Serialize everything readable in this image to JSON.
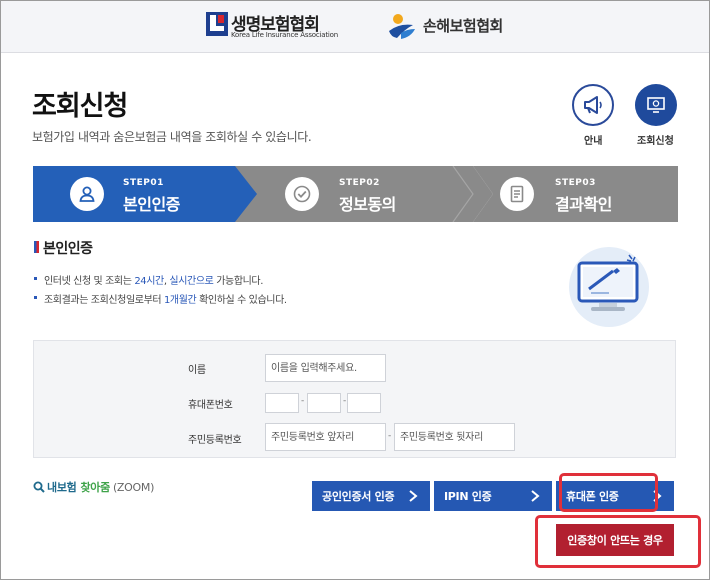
{
  "header": {
    "life_logo_kr": "생명보험협회",
    "life_logo_en": "Korea Life Insurance Association",
    "general_logo": "손해보험협회"
  },
  "page": {
    "title": "조회신청",
    "subtitle": "보험가입 내역과 숨은보험금 내역을 조회하실 수 있습니다."
  },
  "quick_buttons": {
    "guide_label": "안내",
    "guide_icon": "megaphone-icon",
    "request_label": "조회신청",
    "request_icon": "monitor-icon"
  },
  "steps": [
    {
      "num": "STEP01",
      "name": "본인인증",
      "icon": "person-icon",
      "active": true
    },
    {
      "num": "STEP02",
      "name": "정보동의",
      "icon": "check-icon",
      "active": false
    },
    {
      "num": "STEP03",
      "name": "결과확인",
      "icon": "document-icon",
      "active": false
    }
  ],
  "section": {
    "title": "본인인증",
    "bullet1_a": "인터넷 신청 및 조회는 ",
    "bullet1_b": "24시간",
    "bullet1_c": ", ",
    "bullet1_d": "실시간으로",
    "bullet1_e": " 가능합니다.",
    "bullet2_a": "조회결과는 조회신청일로부터 ",
    "bullet2_b": "1개월간",
    "bullet2_c": " 확인하실 수 있습니다."
  },
  "form": {
    "name_label": "이름",
    "name_placeholder": "이름을 입력해주세요.",
    "phone_label": "휴대폰번호",
    "ssn_label": "주민등록번호",
    "ssn_front_placeholder": "주민등록번호 앞자리",
    "ssn_back_placeholder": "주민등록번호 뒷자리"
  },
  "zoom_link": {
    "part1": "내보험",
    "part2": "찾아줌",
    "part3": "(ZOOM)"
  },
  "auth_buttons": {
    "cert": "공인인증서 인증",
    "ipin": "IPIN 인증",
    "phone": "휴대폰 인증",
    "fail": "인증창이 안뜨는 경우"
  },
  "colors": {
    "step_active": "#2460b8",
    "step_inactive": "#8a8a8a",
    "auth_button": "#2558b3",
    "fail_button": "#b22030",
    "highlight_border": "#e0303a"
  }
}
